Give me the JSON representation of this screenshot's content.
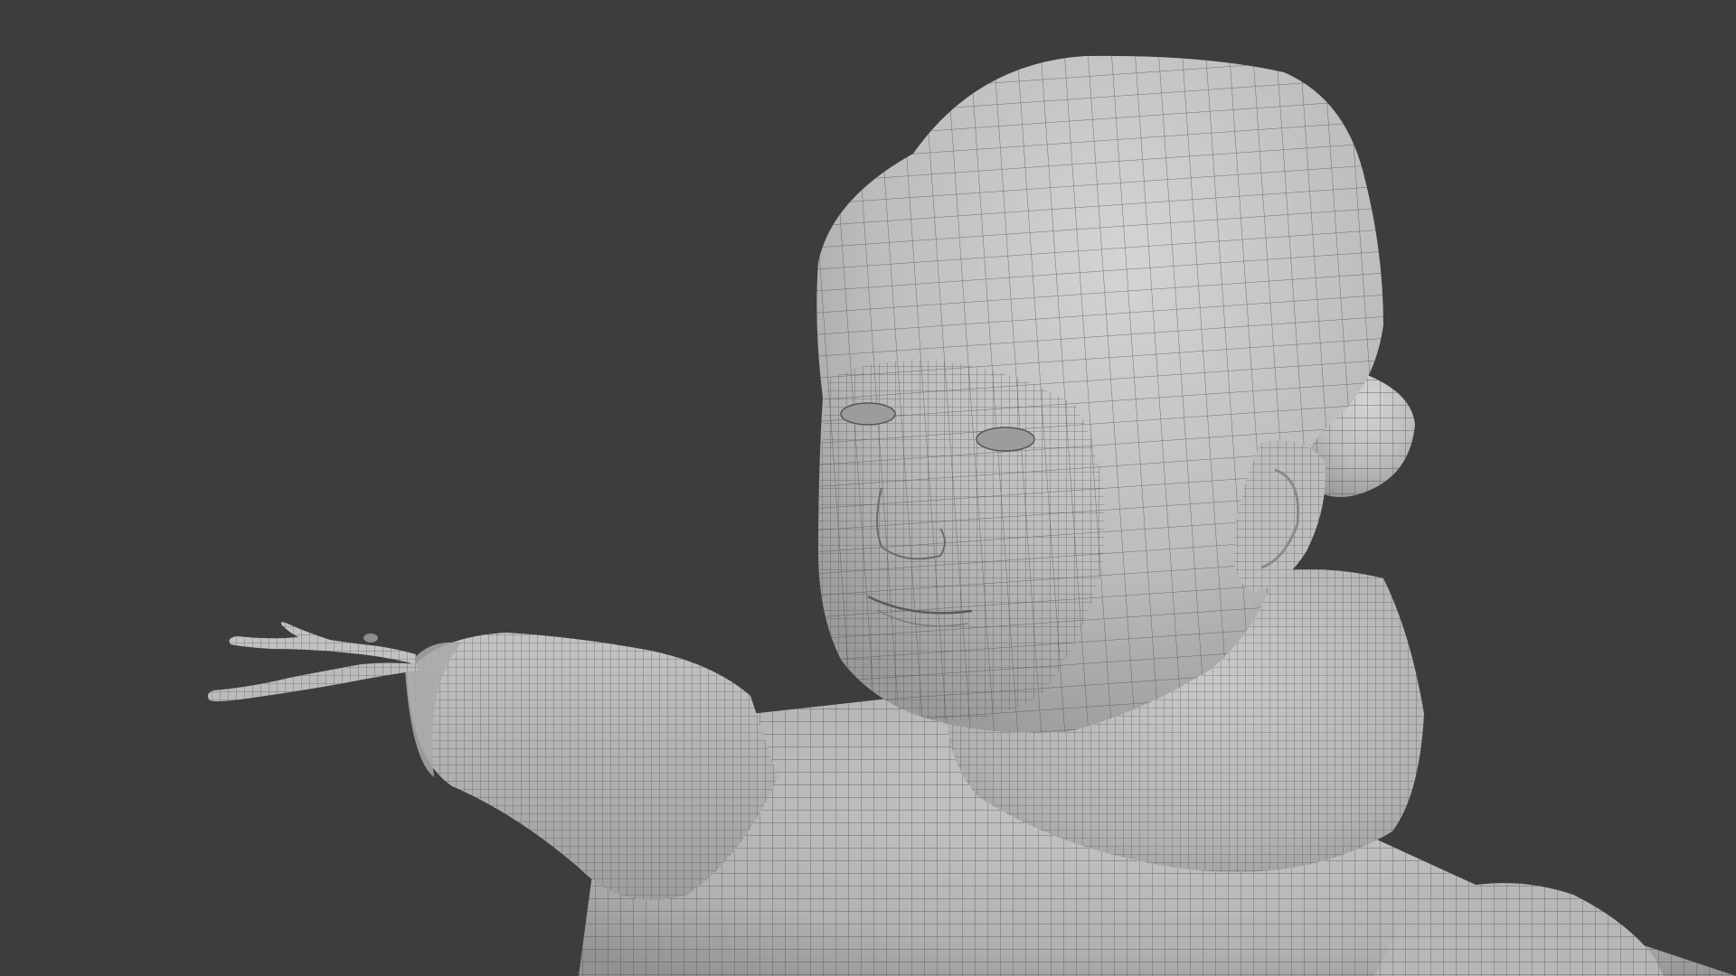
{
  "scene": {
    "type": "3d-viewport-render",
    "shading": "solid-wireframe-overlay",
    "subject_icon": "child-character-mesh",
    "colors": {
      "background": "#3d3d3d",
      "mesh_fill": "#b8b8b8",
      "mesh_highlight": "#d2d2d2",
      "mesh_shadow": "#8f8f8f",
      "wire": "#4a4a4a"
    }
  }
}
